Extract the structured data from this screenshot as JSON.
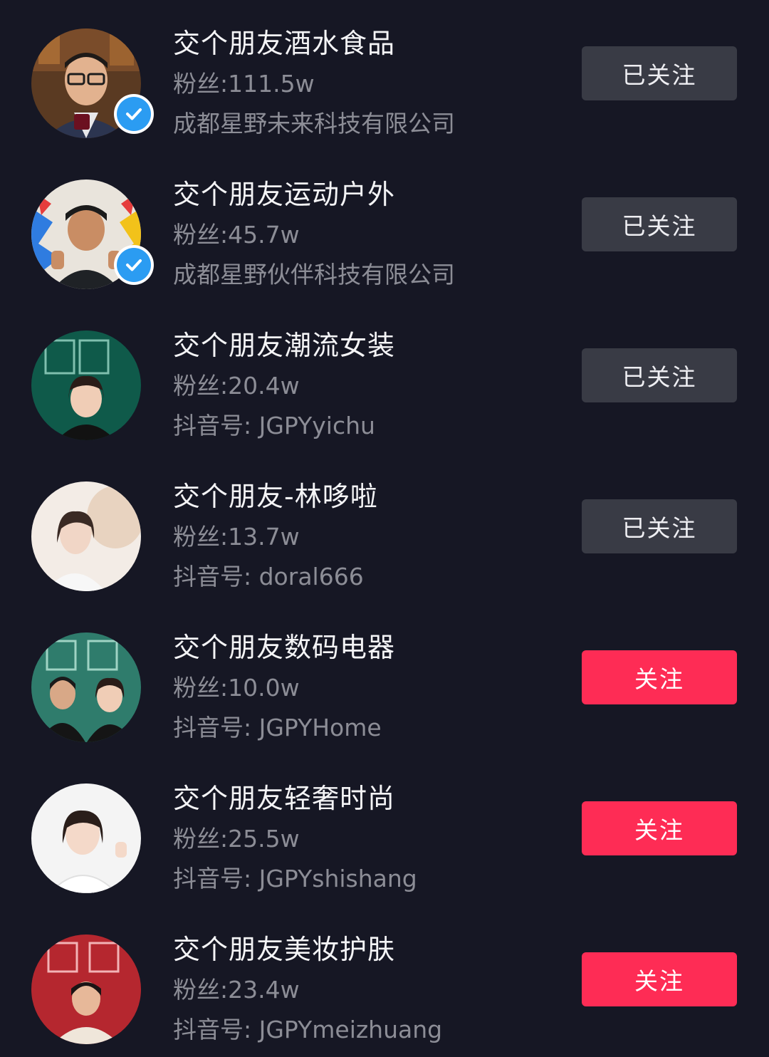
{
  "colors": {
    "background": "#161724",
    "followed_button": "#393b45",
    "follow_button": "#fe2c55",
    "verified_badge": "#2b9cf2"
  },
  "accounts": [
    {
      "name": "交个朋友酒水食品",
      "fans": "粉丝:111.5w",
      "subline": "成都星野未来科技有限公司",
      "button": "已关注",
      "verified": true,
      "followed": true
    },
    {
      "name": "交个朋友运动户外",
      "fans": "粉丝:45.7w",
      "subline": "成都星野伙伴科技有限公司",
      "button": "已关注",
      "verified": true,
      "followed": true
    },
    {
      "name": "交个朋友潮流女装",
      "fans": "粉丝:20.4w",
      "subline": "抖音号: JGPYyichu",
      "button": "已关注",
      "verified": false,
      "followed": true
    },
    {
      "name": "交个朋友-林哆啦",
      "fans": "粉丝:13.7w",
      "subline": "抖音号: doral666",
      "button": "已关注",
      "verified": false,
      "followed": true
    },
    {
      "name": "交个朋友数码电器",
      "fans": "粉丝:10.0w",
      "subline": "抖音号: JGPYHome",
      "button": "关注",
      "verified": false,
      "followed": false
    },
    {
      "name": "交个朋友轻奢时尚",
      "fans": "粉丝:25.5w",
      "subline": "抖音号: JGPYshishang",
      "button": "关注",
      "verified": false,
      "followed": false
    },
    {
      "name": "交个朋友美妆护肤",
      "fans": "粉丝:23.4w",
      "subline": "抖音号: JGPYmeizhuang",
      "button": "关注",
      "verified": false,
      "followed": false
    }
  ]
}
